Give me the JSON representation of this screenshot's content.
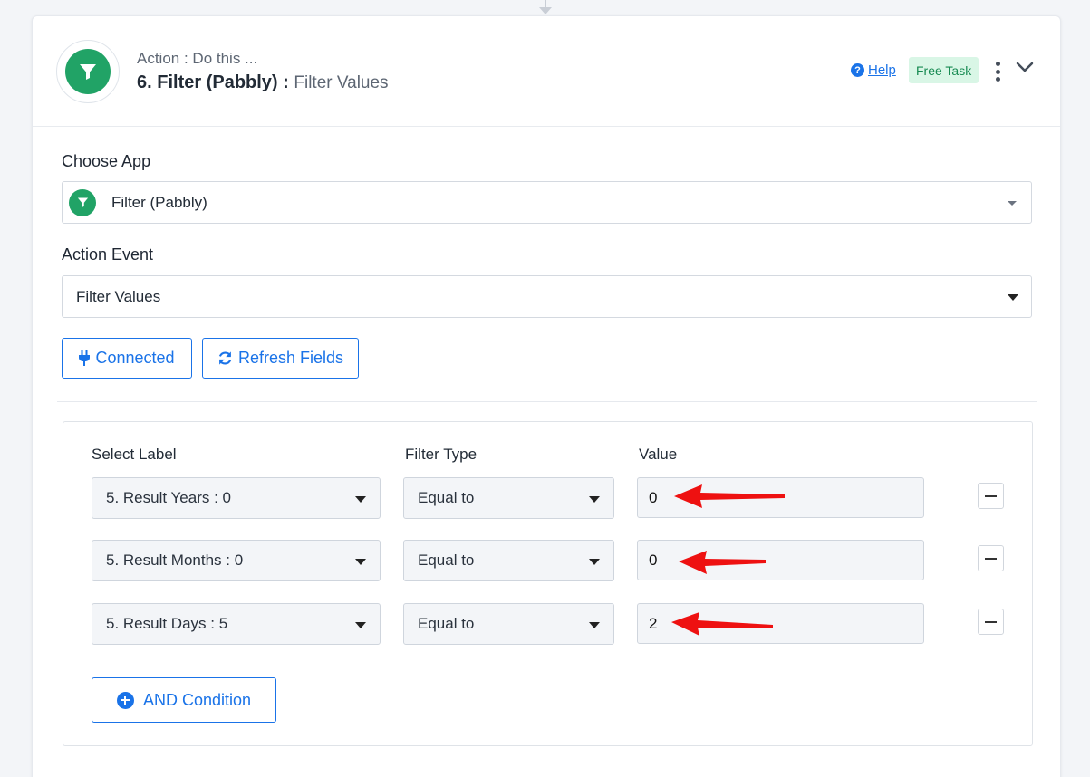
{
  "step": {
    "subtitle": "Action : Do this ...",
    "title_main": "6. Filter (Pabbly) :",
    "title_event": "Filter Values",
    "help_label": "Help",
    "badge": "Free Task"
  },
  "choose_app": {
    "label": "Choose App",
    "value": "Filter (Pabbly)"
  },
  "action_event": {
    "label": "Action Event",
    "value": "Filter Values"
  },
  "buttons": {
    "connected": "Connected",
    "refresh": "Refresh Fields",
    "and_condition": "AND Condition"
  },
  "filter": {
    "col_label": "Select Label",
    "col_type": "Filter Type",
    "col_value": "Value",
    "rows": [
      {
        "label": "5. Result Years : 0",
        "type": "Equal to",
        "value": "0"
      },
      {
        "label": "5. Result Months : 0",
        "type": "Equal to",
        "value": "0"
      },
      {
        "label": "5. Result Days : 5",
        "type": "Equal to",
        "value": "2"
      }
    ]
  },
  "colors": {
    "accent": "#1a73e8",
    "app_green": "#21a366",
    "badge_bg": "#d9f6e6",
    "badge_text": "#178a52",
    "annotation_arrow": "#ee1111"
  },
  "icons": {
    "app": "funnel-icon",
    "help": "question-circle-icon",
    "menu": "kebab-icon",
    "collapse": "chevron-down-icon",
    "connected": "plug-icon",
    "refresh": "refresh-icon",
    "remove": "minus-icon",
    "add": "plus-circle-icon"
  }
}
